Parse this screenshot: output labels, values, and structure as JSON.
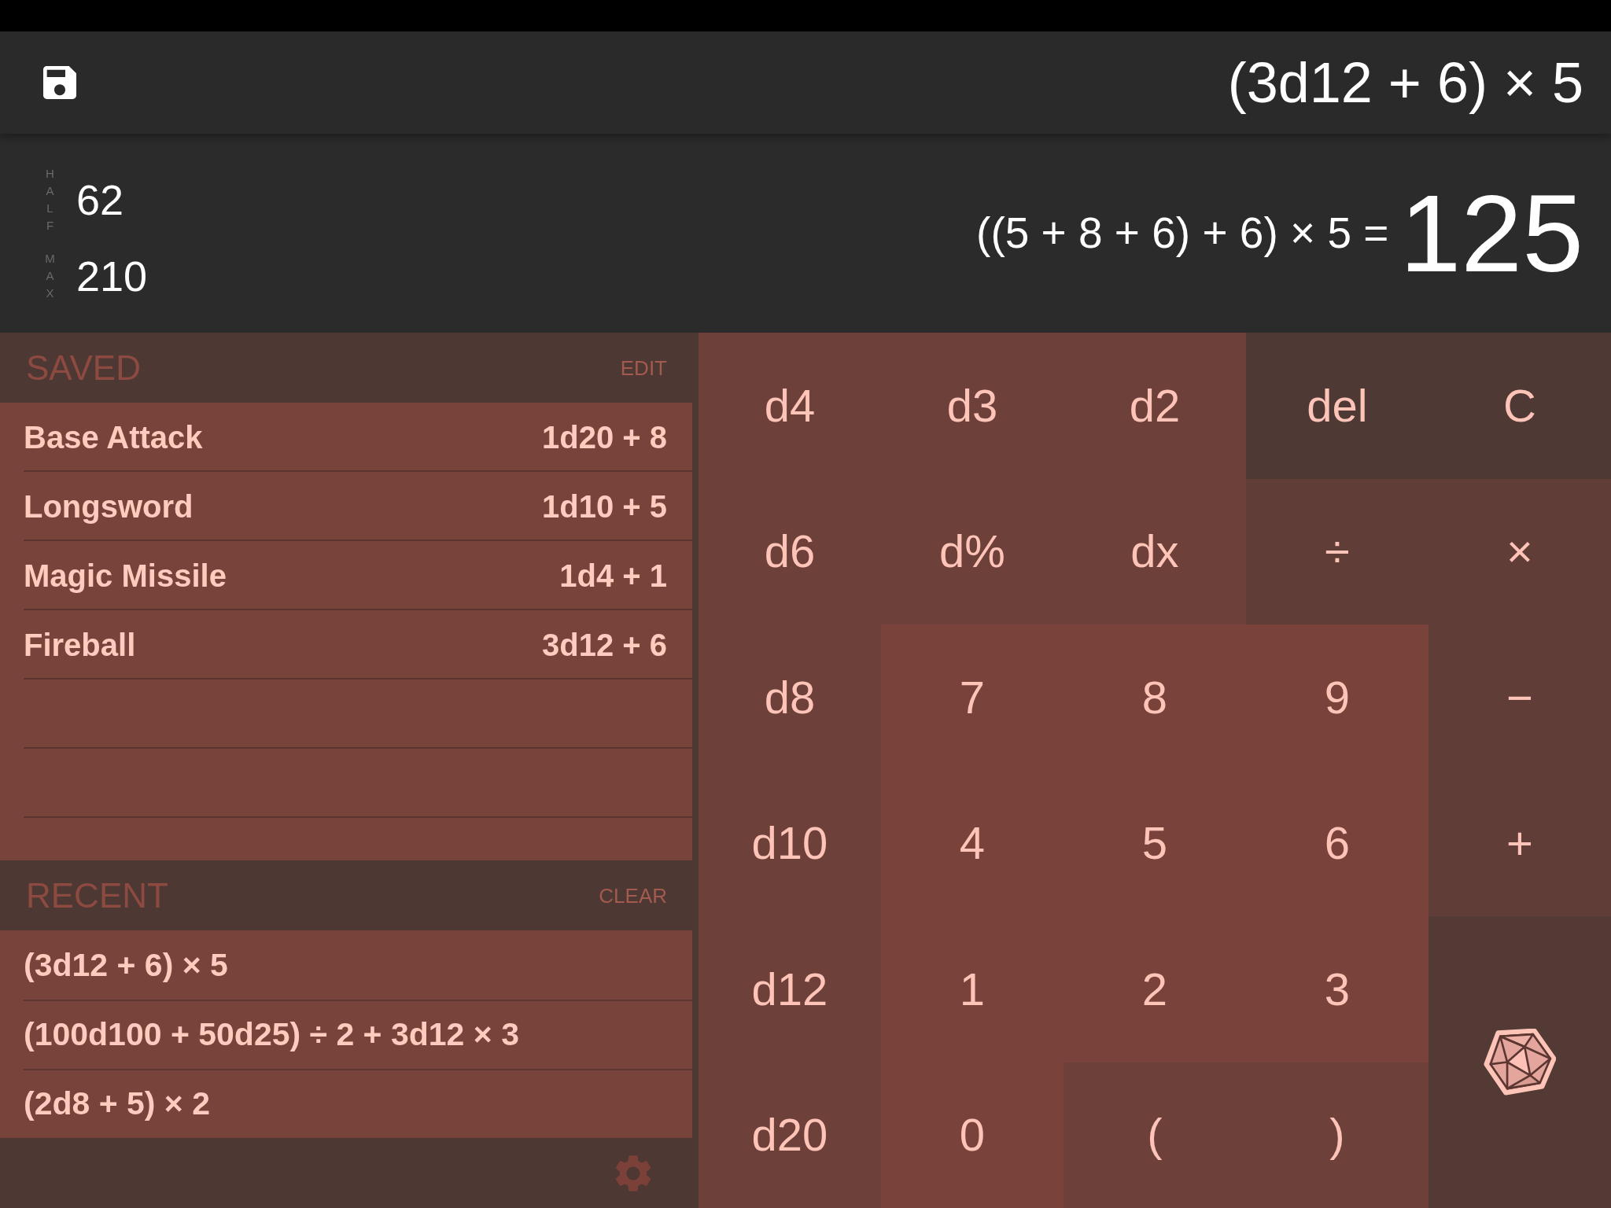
{
  "header": {
    "expression": "(3d12 + 6) × 5"
  },
  "display": {
    "stats": [
      {
        "label": "HALF",
        "value": "62"
      },
      {
        "label": "MAX",
        "value": "210"
      }
    ],
    "breakdown": "((5 + 8 + 6) + 6) × 5 =",
    "result": "125"
  },
  "saved": {
    "title": "SAVED",
    "action": "EDIT",
    "items": [
      {
        "name": "Base Attack",
        "formula": "1d20 + 8"
      },
      {
        "name": "Longsword",
        "formula": "1d10 + 5"
      },
      {
        "name": "Magic Missile",
        "formula": "1d4 + 1"
      },
      {
        "name": "Fireball",
        "formula": "3d12 + 6"
      }
    ]
  },
  "recent": {
    "title": "RECENT",
    "action": "CLEAR",
    "items": [
      "(3d12 + 6) × 5",
      "(100d100 + 50d25) ÷ 2 + 3d12 × 3",
      "(2d8 + 5) × 2"
    ]
  },
  "keypad": {
    "keys": [
      {
        "label": "d4",
        "kind": "die"
      },
      {
        "label": "d3",
        "kind": "die"
      },
      {
        "label": "d2",
        "kind": "die"
      },
      {
        "label": "del",
        "kind": "delete"
      },
      {
        "label": "C",
        "kind": "clear"
      },
      {
        "label": "d6",
        "kind": "die"
      },
      {
        "label": "d%",
        "kind": "die"
      },
      {
        "label": "dx",
        "kind": "die"
      },
      {
        "label": "÷",
        "kind": "operator"
      },
      {
        "label": "×",
        "kind": "operator"
      },
      {
        "label": "d8",
        "kind": "die"
      },
      {
        "label": "7",
        "kind": "digit"
      },
      {
        "label": "8",
        "kind": "digit"
      },
      {
        "label": "9",
        "kind": "digit"
      },
      {
        "label": "−",
        "kind": "operator"
      },
      {
        "label": "d10",
        "kind": "die"
      },
      {
        "label": "4",
        "kind": "digit"
      },
      {
        "label": "5",
        "kind": "digit"
      },
      {
        "label": "6",
        "kind": "digit"
      },
      {
        "label": "+",
        "kind": "operator"
      },
      {
        "label": "d12",
        "kind": "die"
      },
      {
        "label": "1",
        "kind": "digit"
      },
      {
        "label": "2",
        "kind": "digit"
      },
      {
        "label": "3",
        "kind": "digit"
      },
      {
        "kind": "roll"
      },
      {
        "label": "d20",
        "kind": "die"
      },
      {
        "label": "0",
        "kind": "digit"
      },
      {
        "label": "(",
        "kind": "paren"
      },
      {
        "label": ")",
        "kind": "paren"
      }
    ]
  }
}
